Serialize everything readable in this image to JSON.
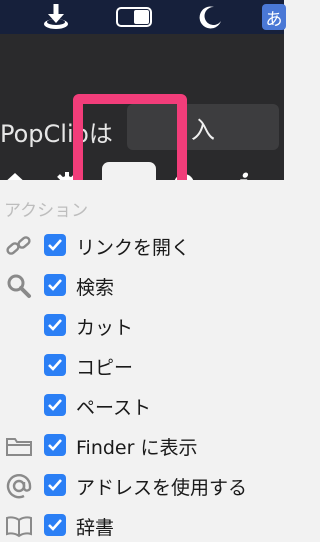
{
  "menubar": {
    "input_mode": "あ"
  },
  "window": {
    "title_text": "PopClipは",
    "ime_candidate": "入"
  },
  "tabs": [
    {
      "name": "home"
    },
    {
      "name": "settings"
    },
    {
      "name": "extensions",
      "selected": true
    },
    {
      "name": "block"
    },
    {
      "name": "about"
    }
  ],
  "tabs_info_glyph": "i",
  "actions": {
    "section_label": "アクション",
    "items": [
      {
        "label": "リンクを開く",
        "icon": "link-icon",
        "checked": true
      },
      {
        "label": "検索",
        "icon": "magnifier-icon",
        "checked": true
      },
      {
        "label": "カット",
        "icon": "",
        "checked": true
      },
      {
        "label": "コピー",
        "icon": "",
        "checked": true
      },
      {
        "label": "ペースト",
        "icon": "",
        "checked": true
      },
      {
        "label": "Finder に表示",
        "icon": "folder-icon",
        "checked": true
      },
      {
        "label": "アドレスを使用する",
        "icon": "at-sign-icon",
        "checked": true
      },
      {
        "label": "辞書",
        "icon": "book-icon",
        "checked": true
      }
    ]
  },
  "colors": {
    "menubar": "#16203b",
    "header": "#2a2a2c",
    "highlight": "#f23d7a",
    "checkbox": "#2b7ff5"
  }
}
